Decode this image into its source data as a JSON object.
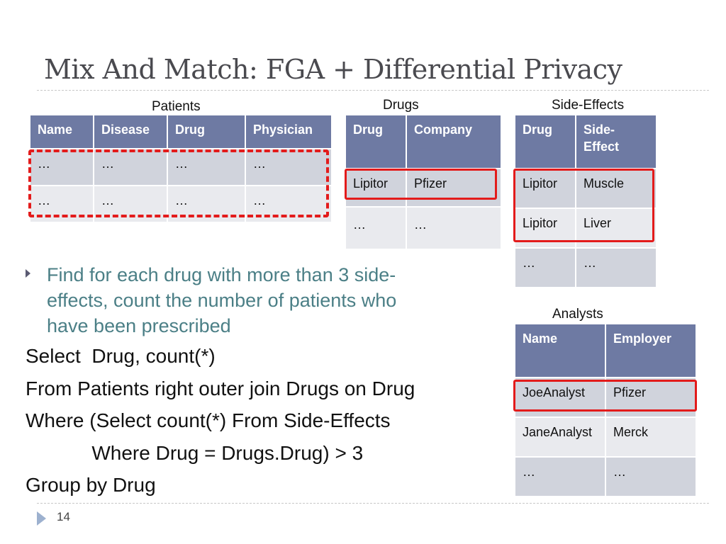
{
  "slide": {
    "title": "Mix And Match: FGA + Differential Privacy",
    "page_number": "14"
  },
  "tables": {
    "patients": {
      "caption": "Patients",
      "headers": [
        "Name",
        "Disease",
        "Drug",
        "Physician"
      ],
      "rows": [
        [
          "…",
          "…",
          "…",
          "…"
        ],
        [
          "…",
          "…",
          "…",
          "…"
        ]
      ]
    },
    "drugs": {
      "caption": "Drugs",
      "headers": [
        "Drug",
        "Company"
      ],
      "rows": [
        [
          "Lipitor",
          "Pfizer"
        ],
        [
          "…",
          "…"
        ]
      ]
    },
    "side_effects": {
      "caption": "Side-Effects",
      "headers": [
        "Drug",
        "Side-\nEffect"
      ],
      "header_lines": [
        "Side-",
        "Effect"
      ],
      "rows": [
        [
          "Lipitor",
          "Muscle"
        ],
        [
          "Lipitor",
          "Liver"
        ],
        [
          "…",
          "…"
        ]
      ]
    },
    "analysts": {
      "caption": "Analysts",
      "headers": [
        "Name",
        "Employer"
      ],
      "rows": [
        [
          "JoeAnalyst",
          "Pfizer"
        ],
        [
          "JaneAnalyst",
          "Merck"
        ],
        [
          "…",
          "…"
        ]
      ]
    }
  },
  "bullet": {
    "text": "Find for each drug with more than 3 side-effects, count the number of patients who have been prescribed",
    "lines": [
      "Find for each drug with more than 3 side-",
      "effects, count the number of patients who",
      "have been prescribed"
    ]
  },
  "sql": {
    "lines": [
      "Select  Drug, count(*)",
      "From Patients right outer join Drugs on Drug",
      "Where (Select count(*) From Side-Effects",
      "            Where Drug = Drugs.Drug) > 3",
      "Group by Drug"
    ]
  },
  "colors": {
    "header_bg": "#6e7aa3",
    "row_dark": "#d0d3dc",
    "row_light": "#e9eaee",
    "highlight": "#e31b1b",
    "bullet_text": "#4b7f86"
  }
}
